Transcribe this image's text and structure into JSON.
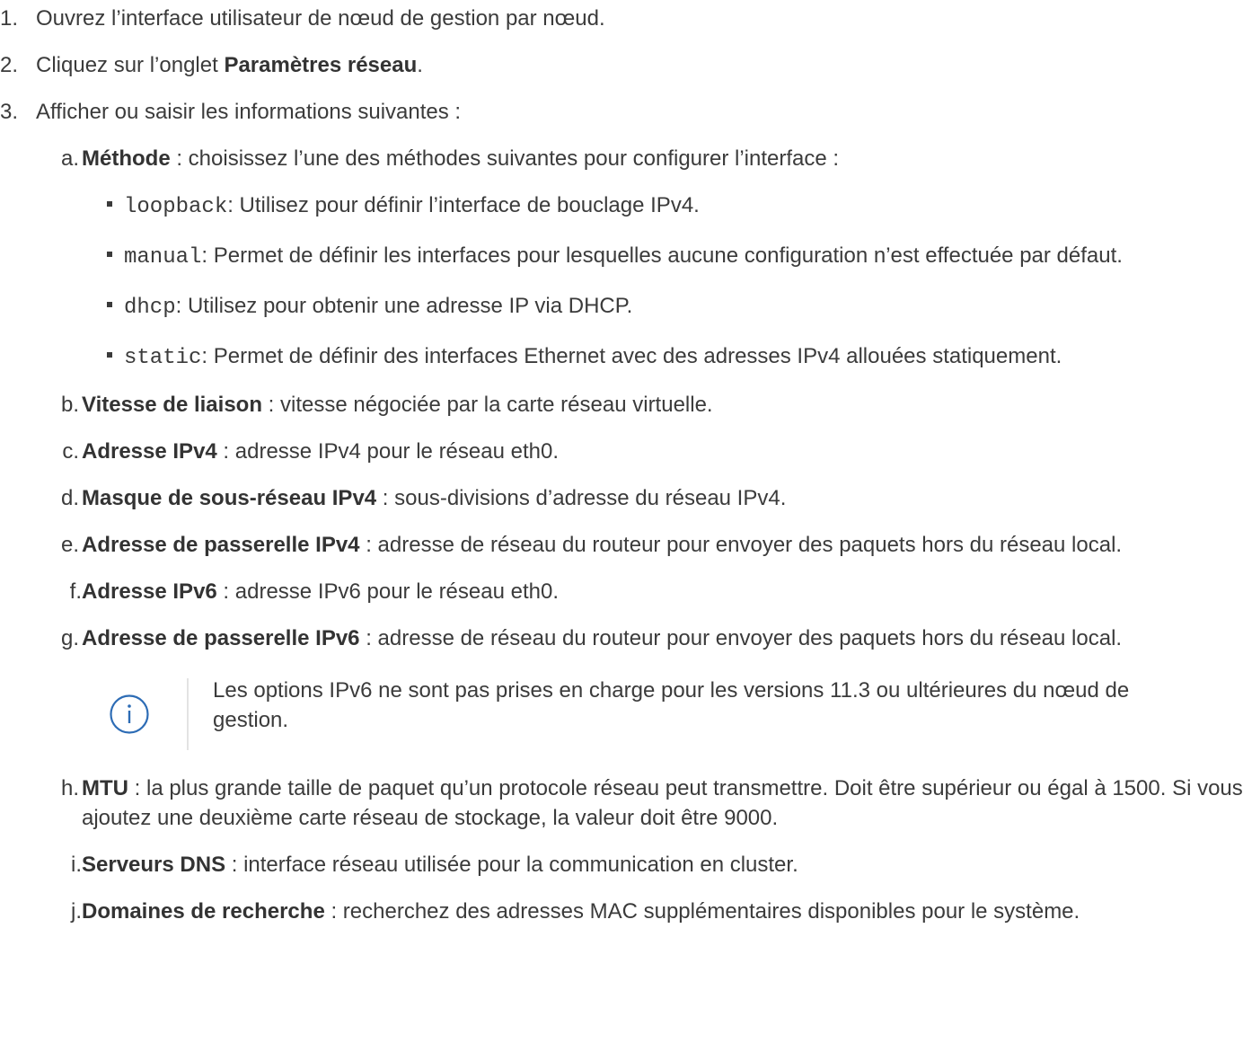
{
  "steps": [
    {
      "num": "1.",
      "text": "Ouvrez l’interface utilisateur de nœud de gestion par nœud."
    },
    {
      "num": "2.",
      "pre": "Cliquez sur l’onglet ",
      "bold": "Paramètres réseau",
      "post": "."
    },
    {
      "num": "3.",
      "text": "Afficher ou saisir les informations suivantes :"
    }
  ],
  "items": {
    "a": {
      "marker": "a.",
      "bold": "Méthode",
      "text": " : choisissez l’une des méthodes suivantes pour configurer l’interface :"
    },
    "b": {
      "marker": "b.",
      "bold": "Vitesse de liaison",
      "text": " : vitesse négociée par la carte réseau virtuelle."
    },
    "c": {
      "marker": "c.",
      "bold": "Adresse IPv4",
      "text": " : adresse IPv4 pour le réseau eth0."
    },
    "d": {
      "marker": "d.",
      "bold": "Masque de sous-réseau IPv4",
      "text": " : sous-divisions d’adresse du réseau IPv4."
    },
    "e": {
      "marker": "e.",
      "bold": "Adresse de passerelle IPv4",
      "text": " : adresse de réseau du routeur pour envoyer des paquets hors du réseau local."
    },
    "f": {
      "marker": "f.",
      "bold": "Adresse IPv6",
      "text": " : adresse IPv6 pour le réseau eth0."
    },
    "g": {
      "marker": "g.",
      "bold": "Adresse de passerelle IPv6",
      "text": " : adresse de réseau du routeur pour envoyer des paquets hors du réseau local."
    },
    "h": {
      "marker": "h.",
      "bold": "MTU",
      "text": " : la plus grande taille de paquet qu’un protocole réseau peut transmettre. Doit être supérieur ou égal à 1500. Si vous ajoutez une deuxième carte réseau de stockage, la valeur doit être 9000."
    },
    "i": {
      "marker": "i.",
      "bold": "Serveurs DNS",
      "text": " : interface réseau utilisée pour la communication en cluster."
    },
    "j": {
      "marker": "j.",
      "bold": "Domaines de recherche",
      "text": " : recherchez des adresses MAC supplémentaires disponibles pour le système."
    }
  },
  "methods": [
    {
      "code": "loopback",
      "text": ": Utilisez pour définir l’interface de bouclage IPv4."
    },
    {
      "code": "manual",
      "text": ": Permet de définir les interfaces pour lesquelles aucune configuration n’est effectuée par défaut."
    },
    {
      "code": "dhcp",
      "text": ": Utilisez pour obtenir une adresse IP via DHCP."
    },
    {
      "code": "static",
      "text": ": Permet de définir des interfaces Ethernet avec des adresses IPv4 allouées statiquement."
    }
  ],
  "note": {
    "icon": "info-icon",
    "text": "Les options IPv6 ne sont pas prises en charge pour les versions 11.3 ou ultérieures du nœud de gestion.",
    "colors": {
      "icon": "#2d6cb5",
      "rule": "#e3e3e3"
    }
  }
}
